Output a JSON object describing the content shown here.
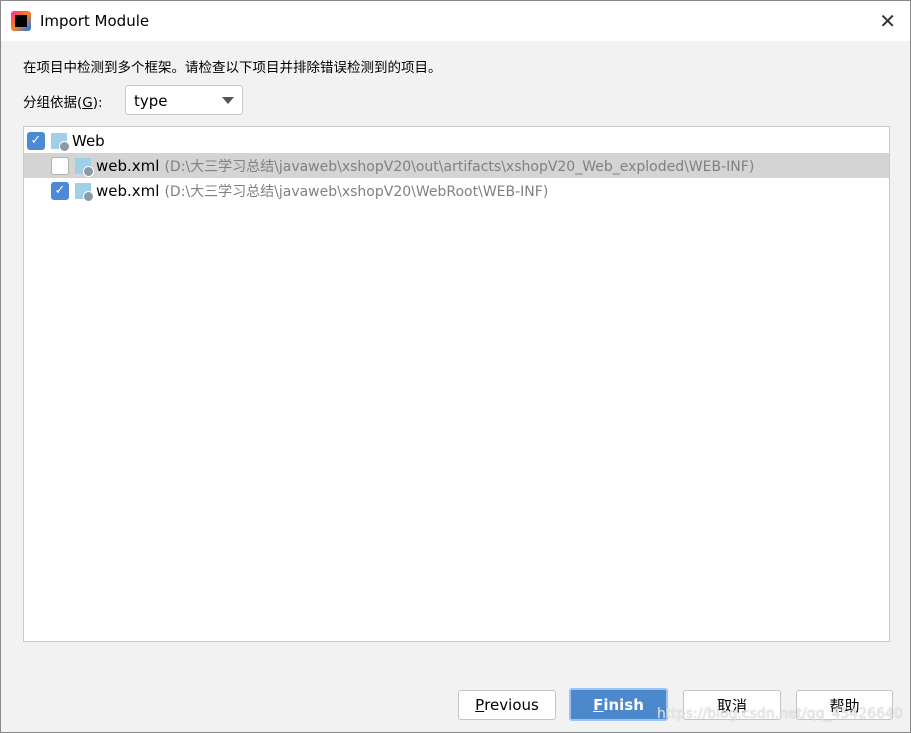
{
  "window": {
    "title": "Import Module"
  },
  "message": "在项目中检测到多个框架。请检查以下项目并排除错误检测到的项目。",
  "group_by": {
    "label_prefix": "分组依据(",
    "mnemonic": "G",
    "label_suffix": "):",
    "value": "type"
  },
  "tree": [
    {
      "name": "Web",
      "path": "",
      "checked": true
    },
    {
      "name": "web.xml",
      "path": "(D:\\大三学习总结\\javaweb\\xshopV20\\out\\artifacts\\xshopV20_Web_exploded\\WEB-INF)",
      "checked": false,
      "selected": true
    },
    {
      "name": "web.xml",
      "path": "(D:\\大三学习总结\\javaweb\\xshopV20\\WebRoot\\WEB-INF)",
      "checked": true
    }
  ],
  "buttons": {
    "previous_m": "P",
    "previous_rest": "revious",
    "finish_m": "F",
    "finish_rest": "inish",
    "cancel": "取消",
    "help": "帮助"
  },
  "watermark": "https://blog.csdn.net/qq_45426640",
  "colors": {
    "accent": "#4c88cc",
    "selected_row": "#d4d4d4"
  }
}
